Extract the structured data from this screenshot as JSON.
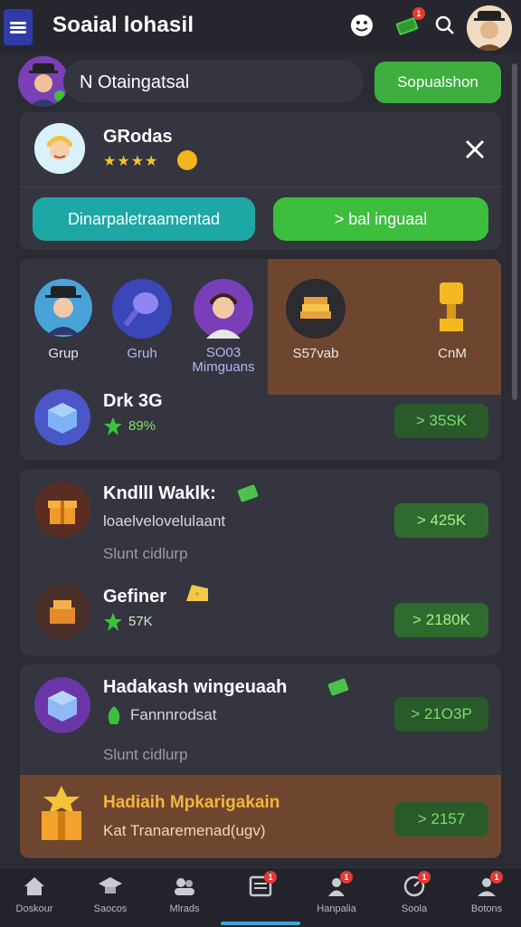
{
  "app": {
    "title": "Soaial lohasil"
  },
  "header": {
    "menu_icon": "hamburger-icon",
    "icons": [
      "smiley-icon",
      "cash-icon",
      "search-icon"
    ],
    "cash_badge": "1"
  },
  "search": {
    "text": "N Otaingatsal",
    "button": "Sopualshon"
  },
  "profile_card": {
    "name": "GRodas",
    "stars": "★★★★",
    "close_icon": "close-icon",
    "button_left": "Dinarpaletraamentad",
    "button_right": "> bal inguaal"
  },
  "grid": {
    "items": [
      {
        "label": "Grup"
      },
      {
        "label": "Gruh"
      },
      {
        "label": "SO03 Mimguans"
      },
      {
        "label": "S57vab"
      },
      {
        "label": "CnM"
      }
    ],
    "feature": {
      "title": "Drk 3G",
      "value": "89%",
      "button": "> 35SK"
    }
  },
  "rewards_card": {
    "rows": [
      {
        "title": "Kndlll Waklk:",
        "sub": "loaelvelovelulaant",
        "muted": "Slunt cidlurp",
        "button": "> 425K"
      },
      {
        "title": "Gefiner",
        "value": "57K",
        "button": "> 2180K"
      }
    ]
  },
  "offers_card": {
    "rows": [
      {
        "title": "Hadakash wingeuaah",
        "sub": "Fannnrodsat",
        "muted": "Slunt cidlurp",
        "button": "> 21O3P"
      },
      {
        "title": "Hadiaih Mpkarigakain",
        "sub": "Kat Tranaremenad(ugv)",
        "button": "> 2157"
      }
    ]
  },
  "bottom_nav": [
    {
      "label": "Doskour",
      "icon": "home-icon"
    },
    {
      "label": "Saocos",
      "icon": "graduation-icon"
    },
    {
      "label": "Mlrads",
      "icon": "people-icon"
    },
    {
      "label": "",
      "icon": "news-icon",
      "badge": "1"
    },
    {
      "label": "Hanpalia",
      "icon": "person-icon",
      "badge": "1"
    },
    {
      "label": "Soola",
      "icon": "gauge-icon",
      "badge": "1"
    },
    {
      "label": "Botons",
      "icon": "profile-icon",
      "badge": "1"
    }
  ],
  "colors": {
    "accent_green": "#3dbf3d",
    "accent_teal": "#1da8a6",
    "menu_blue": "#2f3ca8",
    "highlight_brown": "#6e4630"
  }
}
